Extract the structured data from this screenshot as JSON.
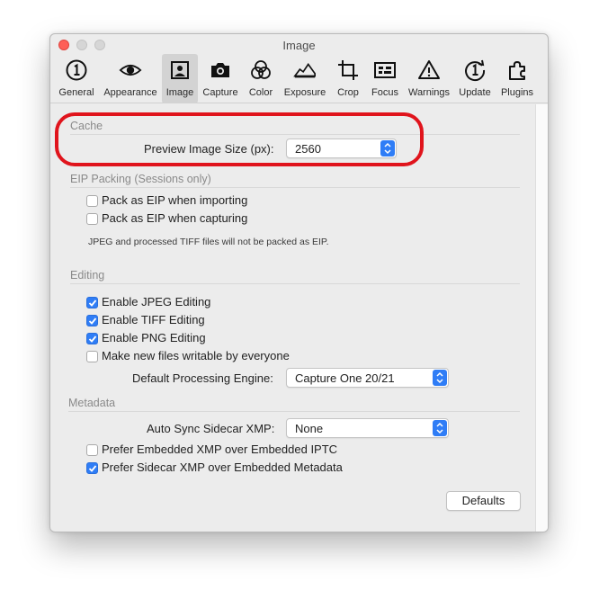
{
  "window": {
    "title": "Image"
  },
  "toolbar": {
    "items": [
      {
        "label": "General",
        "icon": "info-circle-icon",
        "selected": false
      },
      {
        "label": "Appearance",
        "icon": "eye-icon",
        "selected": false
      },
      {
        "label": "Image",
        "icon": "portrait-image-icon",
        "selected": true
      },
      {
        "label": "Capture",
        "icon": "camera-icon",
        "selected": false
      },
      {
        "label": "Color",
        "icon": "color-circles-icon",
        "selected": false
      },
      {
        "label": "Exposure",
        "icon": "histogram-icon",
        "selected": false
      },
      {
        "label": "Crop",
        "icon": "crop-icon",
        "selected": false
      },
      {
        "label": "Focus",
        "icon": "focus-grid-icon",
        "selected": false
      },
      {
        "label": "Warnings",
        "icon": "warning-triangle-icon",
        "selected": false
      },
      {
        "label": "Update",
        "icon": "update-circle-icon",
        "selected": false
      },
      {
        "label": "Plugins",
        "icon": "puzzle-piece-icon",
        "selected": false
      }
    ]
  },
  "cache": {
    "section_title": "Cache",
    "preview_label": "Preview Image Size (px):",
    "preview_value": "2560"
  },
  "eip": {
    "section_title": "EIP Packing (Sessions only)",
    "pack_importing": {
      "label": "Pack as EIP when importing",
      "checked": false
    },
    "pack_capturing": {
      "label": "Pack as EIP when capturing",
      "checked": false
    },
    "note": "JPEG and processed TIFF files will not be packed as EIP."
  },
  "editing": {
    "section_title": "Editing",
    "jpeg": {
      "label": "Enable JPEG Editing",
      "checked": true
    },
    "tiff": {
      "label": "Enable TIFF Editing",
      "checked": true
    },
    "png": {
      "label": "Enable PNG Editing",
      "checked": true
    },
    "writable": {
      "label": "Make new files writable by everyone",
      "checked": false
    },
    "engine_label": "Default Processing Engine:",
    "engine_value": "Capture One 20/21"
  },
  "metadata": {
    "section_title": "Metadata",
    "sync_label": "Auto Sync Sidecar XMP:",
    "sync_value": "None",
    "prefer_embedded": {
      "label": "Prefer Embedded XMP over Embedded IPTC",
      "checked": false
    },
    "prefer_sidecar": {
      "label": "Prefer Sidecar XMP over Embedded Metadata",
      "checked": true
    }
  },
  "defaults_button": "Defaults",
  "colors": {
    "accent": "#2f7df6",
    "highlight": "#e0141c",
    "close": "#fe5f57"
  }
}
